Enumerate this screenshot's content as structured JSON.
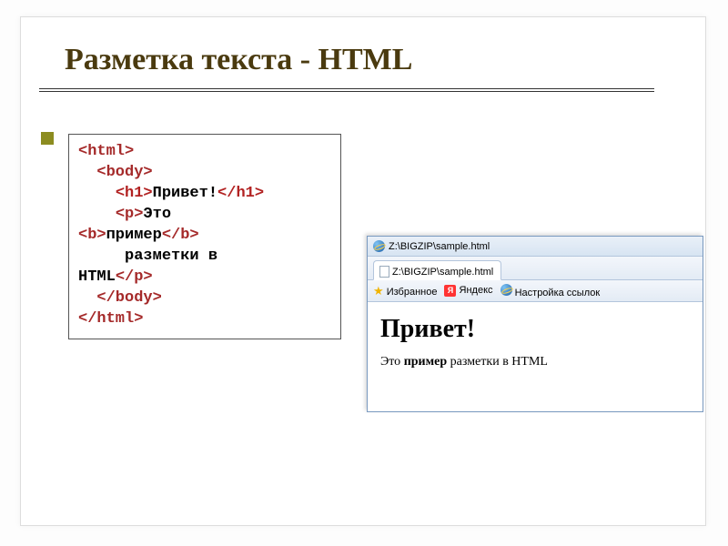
{
  "slide": {
    "title": "Разметка текста - HTML"
  },
  "code": {
    "l1_open": "<html>",
    "l2_open": "<body>",
    "l3_h1o": "<h1>",
    "l3_txt": "Привет!",
    "l3_h1c": "</h1>",
    "l4_po": "<p>",
    "l4_txt": "Это",
    "l5_bo": "<b>",
    "l5_txt": "пример",
    "l5_bc": "</b>",
    "l6_txt": "разметки в",
    "l7_txt": "HTML",
    "l7_pc": "</p>",
    "l8_bodyc": "</body>",
    "l9_htmlc": "</html>"
  },
  "browser": {
    "titlebar_path": "Z:\\BIGZIP\\sample.html",
    "tab_label": "Z:\\BIGZIP\\sample.html",
    "fav_label": "Избранное",
    "yandex_label": "Яндекс",
    "yandex_letter": "Я",
    "links_setup": "Настройка ссылок",
    "page_h1": "Привет!",
    "page_text_prefix": "Это ",
    "page_text_bold": "пример",
    "page_text_suffix": " разметки в HTML"
  }
}
